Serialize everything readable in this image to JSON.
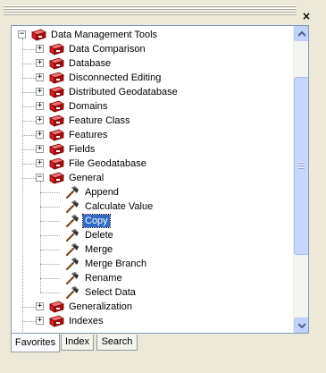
{
  "window": {
    "close_label": "×"
  },
  "tree": {
    "root": {
      "label": "Data Management Tools",
      "expanded": true
    },
    "toolsets_before": [
      {
        "label": "Data Comparison"
      },
      {
        "label": "Database"
      },
      {
        "label": "Disconnected Editing"
      },
      {
        "label": "Distributed Geodatabase"
      },
      {
        "label": "Domains"
      },
      {
        "label": "Feature Class"
      },
      {
        "label": "Features"
      },
      {
        "label": "Fields"
      },
      {
        "label": "File Geodatabase"
      }
    ],
    "open_toolset": {
      "label": "General",
      "expanded": true
    },
    "tools": [
      {
        "label": "Append",
        "icon": "hammer-icon"
      },
      {
        "label": "Calculate Value",
        "icon": "hammer-icon"
      },
      {
        "label": "Copy",
        "icon": "hammer-icon",
        "selected": true
      },
      {
        "label": "Delete",
        "icon": "hammer-icon"
      },
      {
        "label": "Merge",
        "icon": "hammer-icon"
      },
      {
        "label": "Merge Branch",
        "icon": "hammer-icon"
      },
      {
        "label": "Rename",
        "icon": "hammer-icon"
      },
      {
        "label": "Select Data",
        "icon": "hammer-icon"
      }
    ],
    "toolsets_after": [
      {
        "label": "Generalization"
      },
      {
        "label": "Indexes"
      }
    ]
  },
  "tabs": [
    {
      "label": "Favorites",
      "active": true
    },
    {
      "label": "Index",
      "active": false
    },
    {
      "label": "Search",
      "active": false
    }
  ],
  "colors": {
    "selection": "#316ac5",
    "toolbox_red": "#d42020",
    "panel_bg": "#ece9d8"
  }
}
